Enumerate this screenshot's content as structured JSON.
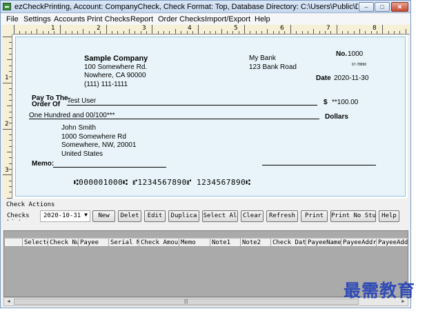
{
  "window": {
    "title": "ezCheckPrinting, Account: CompanyCheck, Check Format: Top, Database Directory: C:\\Users\\Public\\Documents\\Hal...",
    "controls": {
      "minimize": "–",
      "maximize": "□",
      "close": "✕"
    }
  },
  "menu": [
    "File",
    "Settings",
    "Accounts",
    "Print Checks",
    "Report",
    "Order Checks",
    "Import/Export",
    "Help"
  ],
  "ruler": {
    "top_numbers": [
      "1",
      "2",
      "3",
      "4",
      "5",
      "6",
      "7",
      "8"
    ],
    "left_numbers": [
      "1",
      "2",
      "3"
    ]
  },
  "check": {
    "company_name": "Sample Company",
    "company_address1": "100 Somewhere Rd.",
    "company_address2": "Nowhere, CA 90000",
    "company_phone": "(111) 111-1111",
    "bank_name": "My Bank",
    "bank_address": "123 Bank Road",
    "number_label": "No.",
    "number": "1000",
    "fraction_code": "67-78890",
    "date_label": "Date",
    "date": "2020-11-30",
    "pay_to_label": "Pay To The",
    "order_of_label": "Order Of",
    "payee": "Test User",
    "currency_symbol": "$",
    "amount": "**100.00",
    "amount_words": "One Hundred  and 00/100***",
    "dollars_label": "Dollars",
    "address_name": "John Smith",
    "address_line1": "1000 Somewhere Rd",
    "address_line2": "Somewhere, NW, 20001",
    "address_country": "United States",
    "memo_label": "Memo:",
    "micr_line": "⑆000001000⑆ ⑈1234567890⑈ 1234567890⑆"
  },
  "actions": {
    "section_label": "Check Actions",
    "checks_label": "Checks List",
    "date_filter": "2020-10-31",
    "buttons": [
      "New",
      "Delet",
      "Edit",
      "Duplica",
      "Select Al",
      "Clear",
      "Refresh",
      "Print",
      "Print No Stu",
      "Help"
    ]
  },
  "table": {
    "columns": [
      "Selecte",
      "Check Num",
      "Payee",
      "Serial Nu",
      "Check Amount",
      "Memo",
      "Note1",
      "Note2",
      "Check Date",
      "PayeeName",
      "PayeeAddre",
      "PayeeAddre"
    ]
  },
  "scrollbar": {
    "left_arrow": "◄",
    "right_arrow": "►",
    "grip": "|||"
  },
  "watermark": "最需教育"
}
